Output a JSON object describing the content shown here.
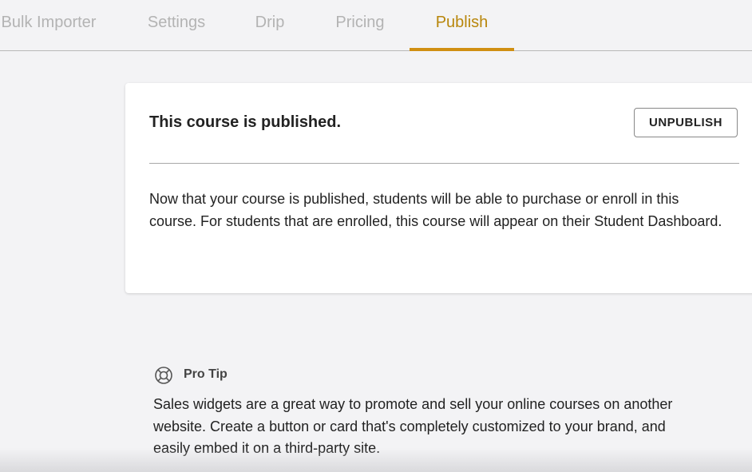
{
  "nav": {
    "tabs": [
      {
        "label": "Bulk Importer",
        "active": false
      },
      {
        "label": "Settings",
        "active": false
      },
      {
        "label": "Drip",
        "active": false
      },
      {
        "label": "Pricing",
        "active": false
      },
      {
        "label": "Publish",
        "active": true
      }
    ]
  },
  "publish_card": {
    "title": "This course is published.",
    "unpublish_label": "UNPUBLISH",
    "description": "Now that your course is published, students will be able to purchase or enroll in this course. For students that are enrolled, this course will appear on their Student Dashboard."
  },
  "pro_tip": {
    "icon": "lifebuoy-icon",
    "label": "Pro Tip",
    "text": "Sales widgets are a great way to promote and sell your online courses on another website. Create a button or card that's completely customized to your brand, and easily embed it on a third-party site."
  },
  "colors": {
    "accent": "#d08f12",
    "background": "#f3f3f5",
    "card": "#ffffff"
  }
}
